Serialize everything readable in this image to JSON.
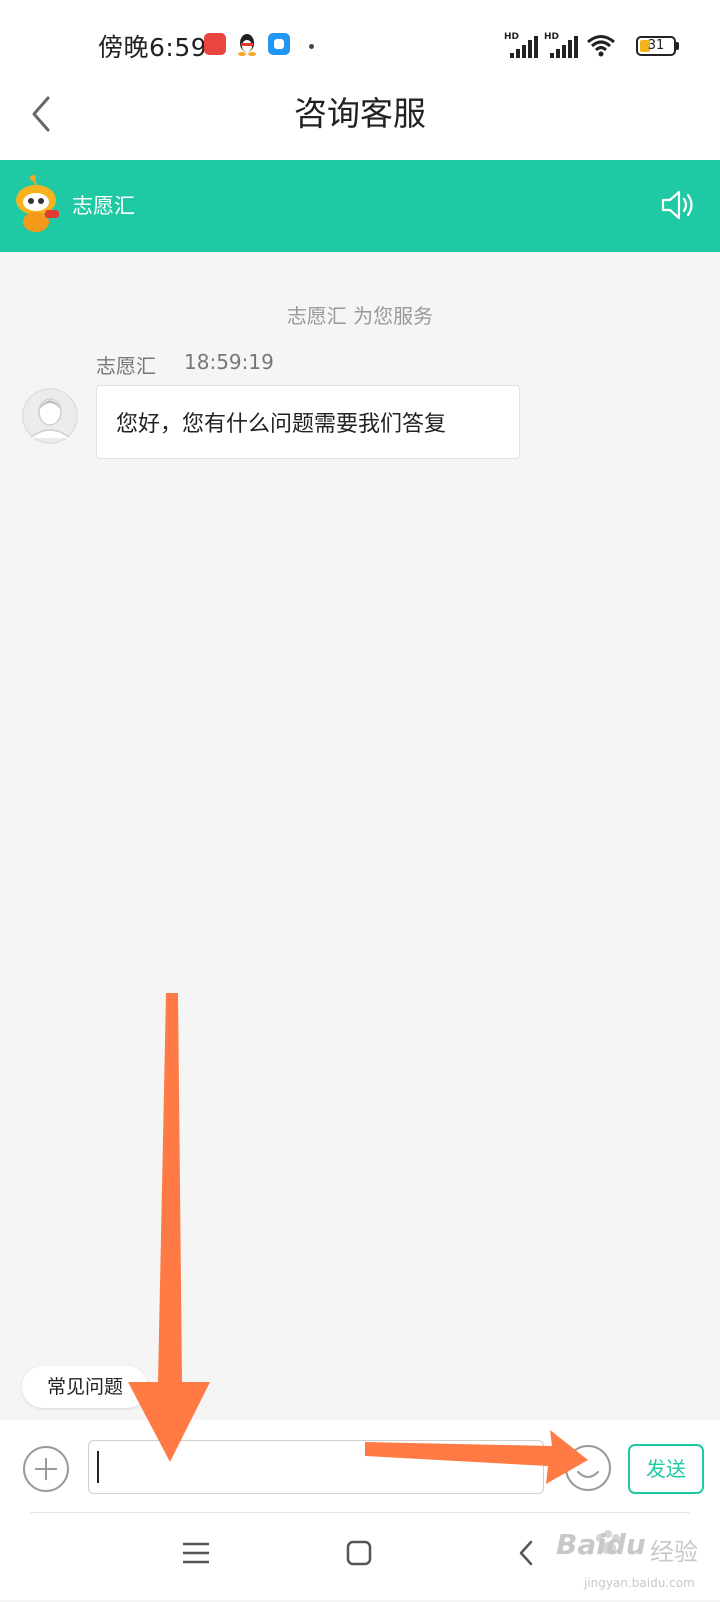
{
  "status_bar": {
    "time": "傍晚6:59",
    "signal_1_label": "HD",
    "signal_2_label": "HD",
    "battery": "31",
    "battery_level": 0.31
  },
  "header": {
    "title": "咨询客服"
  },
  "service_bar": {
    "name": "志愿汇"
  },
  "chat": {
    "system_message": "志愿汇 为您服务",
    "messages": [
      {
        "sender": "志愿汇",
        "time": "18:59:19",
        "text": "您好，您有什么问题需要我们答复"
      }
    ]
  },
  "quick_question": "常见问题",
  "input": {
    "value": "",
    "send_label": "发送"
  },
  "watermark": {
    "brand": "Baidu",
    "cn": "经验",
    "url": "jingyan.baidu.com"
  },
  "colors": {
    "accent": "#1ec9a4",
    "annotation_arrow": "#ff7a45"
  }
}
